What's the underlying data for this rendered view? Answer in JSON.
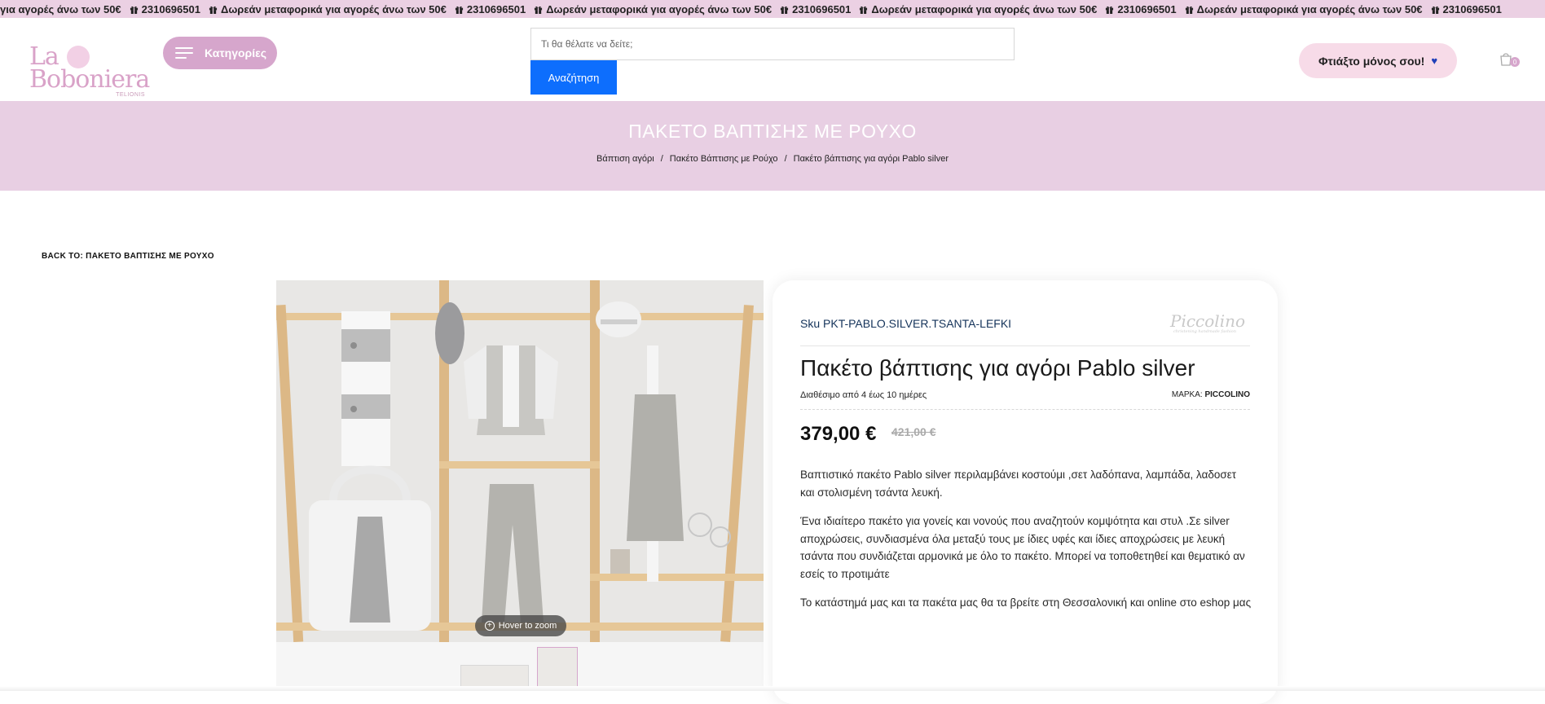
{
  "topbar": {
    "items": [
      {
        "text": "για αγορές άνω των 50€",
        "icon": "gift-icon"
      },
      {
        "text": "2310696501",
        "icon": "gift-icon"
      },
      {
        "text": "Δωρεάν μεταφορικά για αγορές άνω των 50€",
        "icon": "gift-icon"
      },
      {
        "text": "2310696501",
        "icon": "gift-icon"
      },
      {
        "text": "Δωρεάν μεταφορικά για αγορές άνω των 50€",
        "icon": "gift-icon"
      },
      {
        "text": "2310696501",
        "icon": "gift-icon"
      },
      {
        "text": "Δωρεάν μεταφορικά για αγορές άνω των 50€",
        "icon": "gift-icon"
      },
      {
        "text": "2310696501",
        "icon": "gift-icon"
      },
      {
        "text": "Δωρεάν μεταφορικά για αγορές άνω των 50€",
        "icon": "gift-icon"
      },
      {
        "text": "2310696501",
        "icon": "gift-icon"
      }
    ],
    "bg_color": "#ebd0e3"
  },
  "header": {
    "logo_line1": "La",
    "logo_line2": "Boboniera",
    "logo_sub": "TELIONIS",
    "categories_label": "Κατηγορίες",
    "search_placeholder": "Τι θα θέλατε να δείτε;",
    "search_button": "Αναζήτηση",
    "make_button": "Φτιάξτο μόνος σου!",
    "cart_count": "0",
    "accent_color": "#d6a6cc",
    "search_button_color": "#0d6efd"
  },
  "hero": {
    "title": "ΠΑΚΕΤΟ ΒΑΠΤΙΣΗΣ ΜΕ ΡΟΥΧΟ",
    "breadcrumb": [
      "Βάπτιση αγόρι",
      "Πακέτο Βάπτισης με Ρούχο",
      "Πακέτο βάπτισης για αγόρι Pablo silver"
    ],
    "breadcrumb_sep": "/"
  },
  "back_link": "BACK TO: ΠΑΚΕΤΟ ΒΑΠΤΙΣΗΣ ΜΕ ΡΟΥΧΟ",
  "gallery": {
    "zoom_label": "Hover to zoom"
  },
  "product": {
    "sku_label": "Sku PKT-PABLO.SILVER.TSANTA-LEFKI",
    "brand_logo_text": "Piccolino",
    "brand_logo_tagline": "christening handmade fashion",
    "title": "Πακέτο βάπτισης για αγόρι Pablo silver",
    "availability": "Διαθέσιμο από 4 έως 10 ημέρες",
    "brand_label": "ΜΑΡΚΑ:",
    "brand_name": "PICCOLINO",
    "price": "379,00 €",
    "old_price": "421,00 €",
    "description": [
      "Βαπτιστικό πακέτο Pablo silver περιλαμβάνει κοστούμι ,σετ λαδόπανα, λαμπάδα, λαδοσετ και στολισμένη τσάντα λευκή.",
      "Ένα ιδιαίτερο πακέτο για γονείς και νονούς που αναζητούν κομψότητα και στυλ .Σε silver αποχρώσεις, συνδιασμένα όλα  μεταξύ τους με ίδιες υφές και ίδιες αποχρώσεις με λευκή τσάντα που συνδιάζεται αρμονικά με όλο το πακέτο. Μπορεί να τοποθετηθεί και θεματικό αν εσείς το προτιμάτε",
      "Το κατάστημά μας και τα πακέτα μας θα τα βρείτε στη Θεσσαλονική και online στο eshop μας"
    ]
  }
}
